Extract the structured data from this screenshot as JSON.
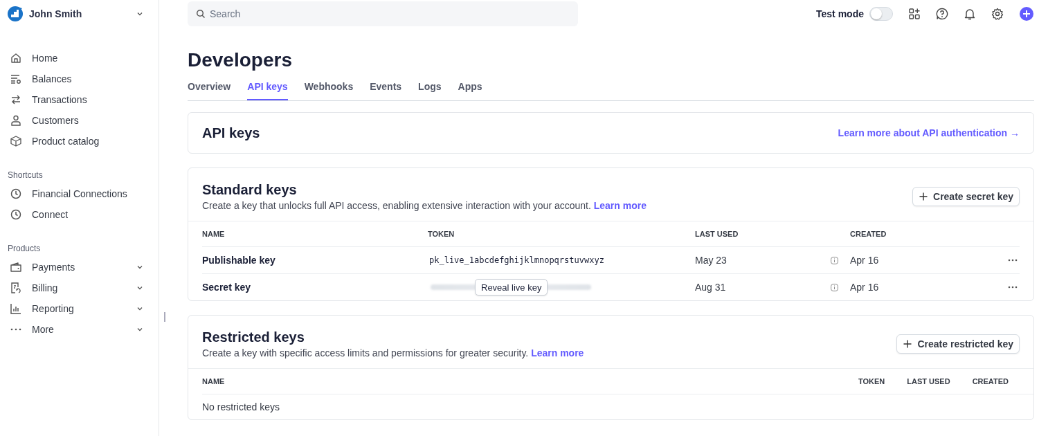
{
  "account": {
    "name": "John Smith",
    "expanded": false
  },
  "nav": [
    {
      "label": "Home"
    },
    {
      "label": "Balances"
    },
    {
      "label": "Transactions"
    },
    {
      "label": "Customers"
    },
    {
      "label": "Product catalog"
    }
  ],
  "shortcuts": {
    "title": "Shortcuts",
    "items": [
      {
        "label": "Financial Connections"
      },
      {
        "label": "Connect"
      }
    ]
  },
  "products": {
    "title": "Products",
    "items": [
      {
        "label": "Payments",
        "expanded": false
      },
      {
        "label": "Billing",
        "expanded": false
      },
      {
        "label": "Reporting",
        "expanded": false
      },
      {
        "label": "More",
        "expanded": false
      }
    ]
  },
  "search": {
    "placeholder": "Search"
  },
  "test_mode": {
    "label": "Test mode",
    "on": false
  },
  "page_title": "Developers",
  "tabs": [
    {
      "label": "Overview",
      "selected": false
    },
    {
      "label": "API keys",
      "selected": true
    },
    {
      "label": "Webhooks",
      "selected": false
    },
    {
      "label": "Events",
      "selected": false
    },
    {
      "label": "Logs",
      "selected": false
    },
    {
      "label": "Apps",
      "selected": false
    }
  ],
  "api_keys": {
    "title": "API keys",
    "link": "Learn more about API authentication →"
  },
  "standard_keys": {
    "title": "Standard keys",
    "description": "Create a key that unlocks full API access, enabling extensive interaction with your account.",
    "link": "Learn more",
    "button": "Create secret key",
    "columns": [
      "NAME",
      "TOKEN",
      "LAST USED",
      "CREATED"
    ],
    "rows": [
      {
        "name": "Publishable key",
        "revealed": true,
        "token": "pk_live_1abcdefghijklmnopqrstuvwxyz",
        "last_used": "May 23",
        "created": "Apr 16"
      },
      {
        "name": "Secret key",
        "revealed": false,
        "reveal_button": "Reveal live key",
        "last_used": "Aug 31",
        "created": "Apr 16"
      }
    ]
  },
  "restricted_keys": {
    "title": "Restricted keys",
    "description": "Create a key with specific access limits and permissions for greater security.",
    "link": "Learn more",
    "button": "Create restricted key",
    "columns": [
      "NAME",
      "TOKEN",
      "LAST USED",
      "CREATED"
    ],
    "empty": "No restricted keys"
  }
}
